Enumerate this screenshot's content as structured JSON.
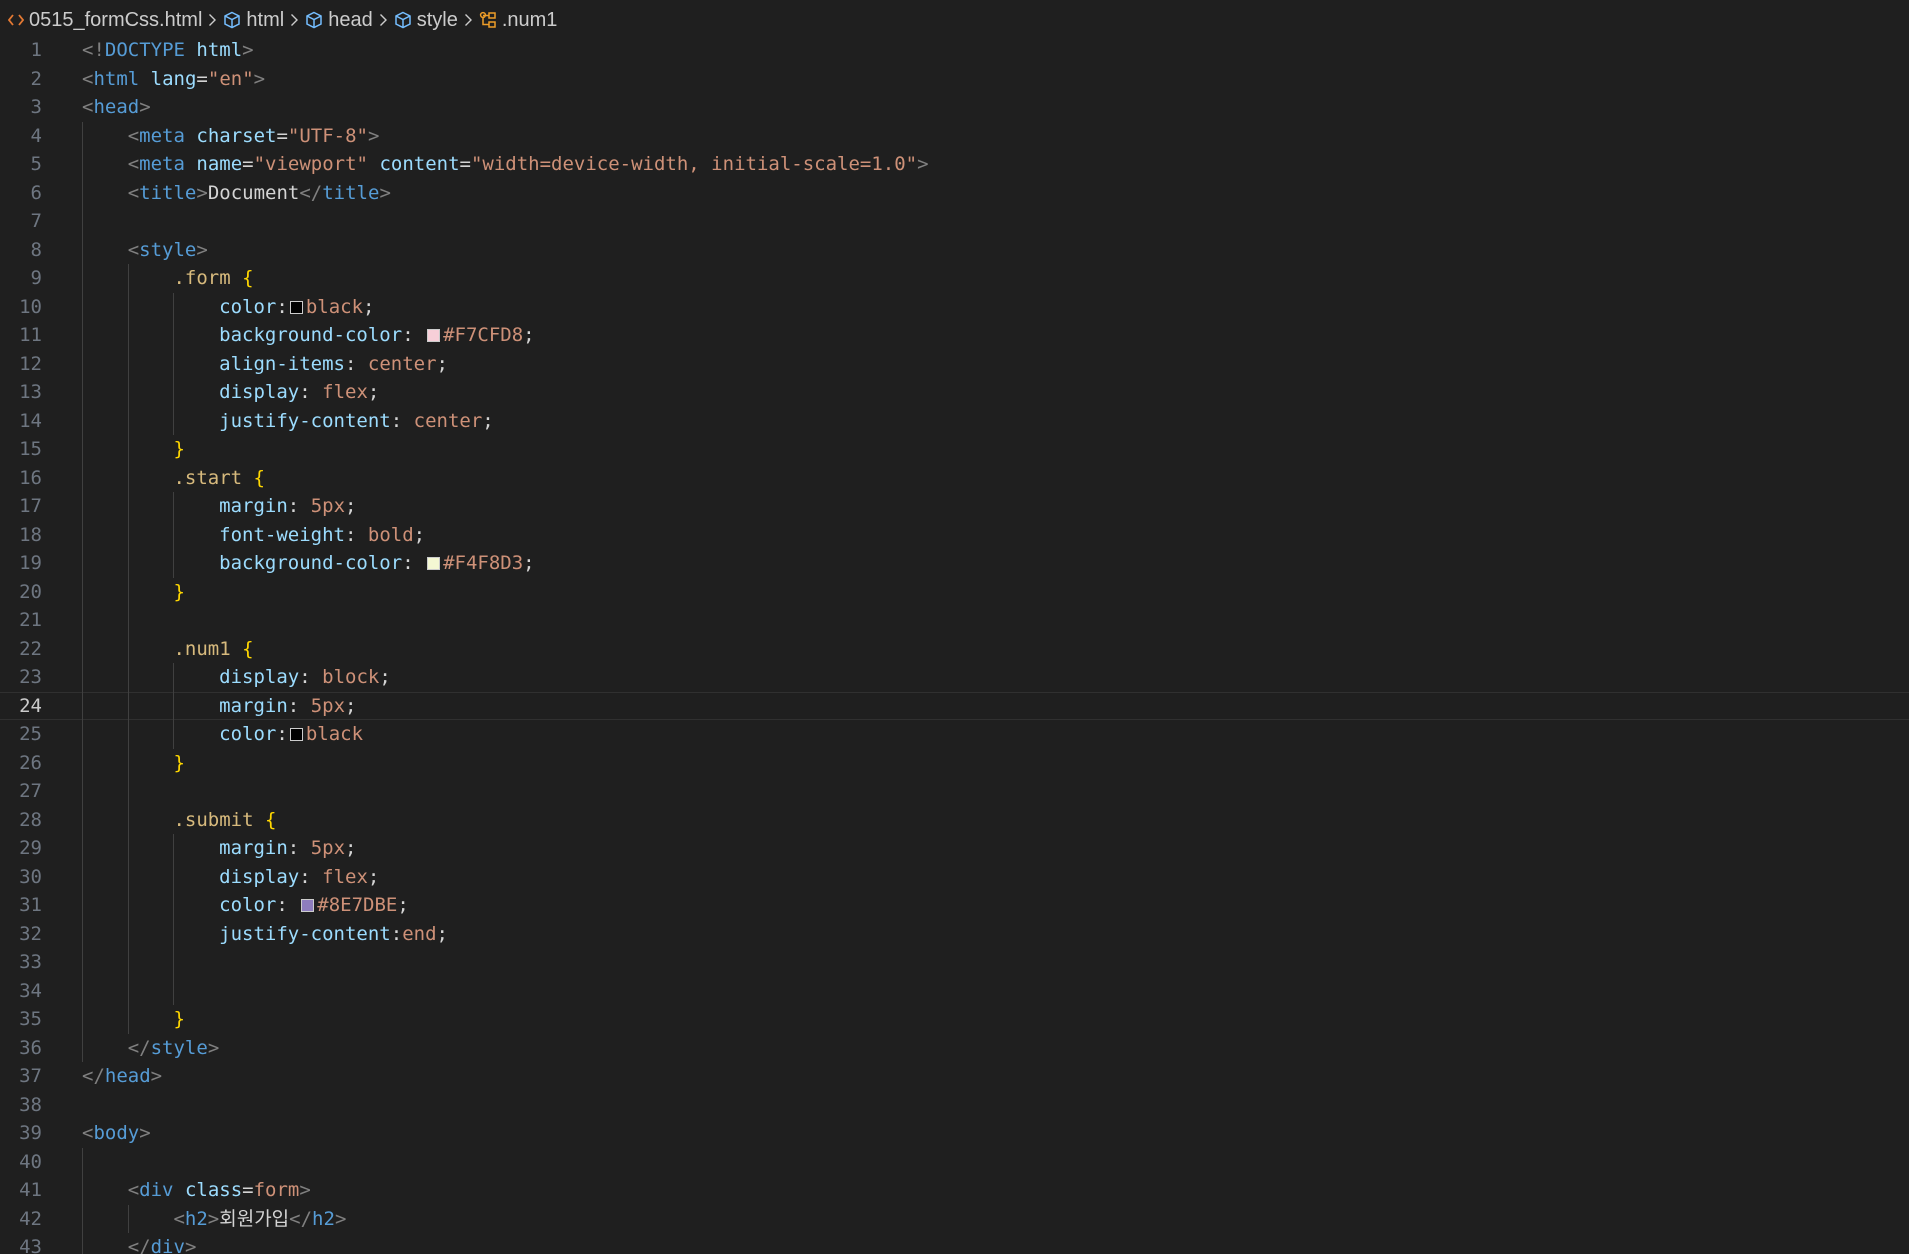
{
  "breadcrumb": {
    "items": [
      {
        "label": "0515_formCss.html",
        "icon": "html-file-icon"
      },
      {
        "label": "html",
        "icon": "element-cube-icon"
      },
      {
        "label": "head",
        "icon": "element-cube-icon"
      },
      {
        "label": "style",
        "icon": "element-cube-icon"
      },
      {
        "label": ".num1",
        "icon": "css-selector-icon"
      }
    ]
  },
  "editor": {
    "current_line": 24,
    "lines": [
      {
        "n": 1,
        "i": 0,
        "t": [
          [
            "t-punct",
            "<!"
          ],
          [
            "t-tag",
            "DOCTYPE "
          ],
          [
            "t-attr",
            "html"
          ],
          [
            "t-punct",
            ">"
          ]
        ]
      },
      {
        "n": 2,
        "i": 0,
        "t": [
          [
            "t-punct",
            "<"
          ],
          [
            "t-tag",
            "html "
          ],
          [
            "t-attr",
            "lang"
          ],
          [
            "t-plain",
            "="
          ],
          [
            "t-str",
            "\"en\""
          ],
          [
            "t-punct",
            ">"
          ]
        ]
      },
      {
        "n": 3,
        "i": 0,
        "t": [
          [
            "t-punct",
            "<"
          ],
          [
            "t-tag",
            "head"
          ],
          [
            "t-punct",
            ">"
          ]
        ]
      },
      {
        "n": 4,
        "i": 1,
        "t": [
          [
            "t-punct",
            "<"
          ],
          [
            "t-tag",
            "meta "
          ],
          [
            "t-attr",
            "charset"
          ],
          [
            "t-plain",
            "="
          ],
          [
            "t-str",
            "\"UTF-8\""
          ],
          [
            "t-punct",
            ">"
          ]
        ]
      },
      {
        "n": 5,
        "i": 1,
        "t": [
          [
            "t-punct",
            "<"
          ],
          [
            "t-tag",
            "meta "
          ],
          [
            "t-attr",
            "name"
          ],
          [
            "t-plain",
            "="
          ],
          [
            "t-str",
            "\"viewport\" "
          ],
          [
            "t-attr",
            "content"
          ],
          [
            "t-plain",
            "="
          ],
          [
            "t-str",
            "\"width=device-width, initial-scale=1.0\""
          ],
          [
            "t-punct",
            ">"
          ]
        ]
      },
      {
        "n": 6,
        "i": 1,
        "t": [
          [
            "t-punct",
            "<"
          ],
          [
            "t-tag",
            "title"
          ],
          [
            "t-punct",
            ">"
          ],
          [
            "t-text",
            "Document"
          ],
          [
            "t-punct",
            "</"
          ],
          [
            "t-tag",
            "title"
          ],
          [
            "t-punct",
            ">"
          ]
        ]
      },
      {
        "n": 7,
        "i": 1,
        "t": []
      },
      {
        "n": 8,
        "i": 1,
        "t": [
          [
            "t-punct",
            "<"
          ],
          [
            "t-tag",
            "style"
          ],
          [
            "t-punct",
            ">"
          ]
        ]
      },
      {
        "n": 9,
        "i": 2,
        "t": [
          [
            "t-sel",
            ".form "
          ],
          [
            "t-brace",
            "{"
          ]
        ]
      },
      {
        "n": 10,
        "i": 3,
        "t": [
          [
            "t-prop",
            "color"
          ],
          [
            "t-plain",
            ":"
          ],
          [
            "swatch",
            "#000000"
          ],
          [
            "t-val",
            "black"
          ],
          [
            "t-plain",
            ";"
          ]
        ]
      },
      {
        "n": 11,
        "i": 3,
        "t": [
          [
            "t-prop",
            "background-color"
          ],
          [
            "t-plain",
            ": "
          ],
          [
            "swatch",
            "#F7CFD8"
          ],
          [
            "t-val",
            "#F7CFD8"
          ],
          [
            "t-plain",
            ";"
          ]
        ]
      },
      {
        "n": 12,
        "i": 3,
        "t": [
          [
            "t-prop",
            "align-items"
          ],
          [
            "t-plain",
            ": "
          ],
          [
            "t-val",
            "center"
          ],
          [
            "t-plain",
            ";"
          ]
        ]
      },
      {
        "n": 13,
        "i": 3,
        "t": [
          [
            "t-prop",
            "display"
          ],
          [
            "t-plain",
            ": "
          ],
          [
            "t-val",
            "flex"
          ],
          [
            "t-plain",
            ";"
          ]
        ]
      },
      {
        "n": 14,
        "i": 3,
        "t": [
          [
            "t-prop",
            "justify-content"
          ],
          [
            "t-plain",
            ": "
          ],
          [
            "t-val",
            "center"
          ],
          [
            "t-plain",
            ";"
          ]
        ]
      },
      {
        "n": 15,
        "i": 2,
        "t": [
          [
            "t-brace",
            "}"
          ]
        ]
      },
      {
        "n": 16,
        "i": 2,
        "t": [
          [
            "t-sel",
            ".start "
          ],
          [
            "t-brace",
            "{"
          ]
        ]
      },
      {
        "n": 17,
        "i": 3,
        "t": [
          [
            "t-prop",
            "margin"
          ],
          [
            "t-plain",
            ": "
          ],
          [
            "t-val",
            "5px"
          ],
          [
            "t-plain",
            ";"
          ]
        ]
      },
      {
        "n": 18,
        "i": 3,
        "t": [
          [
            "t-prop",
            "font-weight"
          ],
          [
            "t-plain",
            ": "
          ],
          [
            "t-val",
            "bold"
          ],
          [
            "t-plain",
            ";"
          ]
        ]
      },
      {
        "n": 19,
        "i": 3,
        "t": [
          [
            "t-prop",
            "background-color"
          ],
          [
            "t-plain",
            ": "
          ],
          [
            "swatch",
            "#F4F8D3"
          ],
          [
            "t-val",
            "#F4F8D3"
          ],
          [
            "t-plain",
            ";"
          ]
        ]
      },
      {
        "n": 20,
        "i": 2,
        "t": [
          [
            "t-brace",
            "}"
          ]
        ]
      },
      {
        "n": 21,
        "i": 2,
        "t": []
      },
      {
        "n": 22,
        "i": 2,
        "t": [
          [
            "t-sel",
            ".num1 "
          ],
          [
            "t-brace",
            "{"
          ]
        ]
      },
      {
        "n": 23,
        "i": 3,
        "t": [
          [
            "t-prop",
            "display"
          ],
          [
            "t-plain",
            ": "
          ],
          [
            "t-val",
            "block"
          ],
          [
            "t-plain",
            ";"
          ]
        ]
      },
      {
        "n": 24,
        "i": 3,
        "t": [
          [
            "t-prop",
            "margin"
          ],
          [
            "t-plain",
            ": "
          ],
          [
            "t-val",
            "5px"
          ],
          [
            "t-plain",
            ";"
          ]
        ]
      },
      {
        "n": 25,
        "i": 3,
        "t": [
          [
            "t-prop",
            "color"
          ],
          [
            "t-plain",
            ":"
          ],
          [
            "swatch",
            "#000000"
          ],
          [
            "t-val",
            "black"
          ]
        ]
      },
      {
        "n": 26,
        "i": 2,
        "t": [
          [
            "t-brace",
            "}"
          ]
        ]
      },
      {
        "n": 27,
        "i": 2,
        "t": []
      },
      {
        "n": 28,
        "i": 2,
        "t": [
          [
            "t-sel",
            ".submit "
          ],
          [
            "t-brace",
            "{"
          ]
        ]
      },
      {
        "n": 29,
        "i": 3,
        "t": [
          [
            "t-prop",
            "margin"
          ],
          [
            "t-plain",
            ": "
          ],
          [
            "t-val",
            "5px"
          ],
          [
            "t-plain",
            ";"
          ]
        ]
      },
      {
        "n": 30,
        "i": 3,
        "t": [
          [
            "t-prop",
            "display"
          ],
          [
            "t-plain",
            ": "
          ],
          [
            "t-val",
            "flex"
          ],
          [
            "t-plain",
            ";"
          ]
        ]
      },
      {
        "n": 31,
        "i": 3,
        "t": [
          [
            "t-prop",
            "color"
          ],
          [
            "t-plain",
            ": "
          ],
          [
            "swatch",
            "#8E7DBE"
          ],
          [
            "t-val",
            "#8E7DBE"
          ],
          [
            "t-plain",
            ";"
          ]
        ]
      },
      {
        "n": 32,
        "i": 3,
        "t": [
          [
            "t-prop",
            "justify-content"
          ],
          [
            "t-plain",
            ":"
          ],
          [
            "t-val",
            "end"
          ],
          [
            "t-plain",
            ";"
          ]
        ]
      },
      {
        "n": 33,
        "i": 3,
        "t": []
      },
      {
        "n": 34,
        "i": 3,
        "t": []
      },
      {
        "n": 35,
        "i": 2,
        "t": [
          [
            "t-brace",
            "}"
          ]
        ]
      },
      {
        "n": 36,
        "i": 1,
        "t": [
          [
            "t-punct",
            "</"
          ],
          [
            "t-tag",
            "style"
          ],
          [
            "t-punct",
            ">"
          ]
        ]
      },
      {
        "n": 37,
        "i": 0,
        "t": [
          [
            "t-punct",
            "</"
          ],
          [
            "t-tag",
            "head"
          ],
          [
            "t-punct",
            ">"
          ]
        ]
      },
      {
        "n": 38,
        "i": 0,
        "t": []
      },
      {
        "n": 39,
        "i": 0,
        "t": [
          [
            "t-punct",
            "<"
          ],
          [
            "t-tag",
            "body"
          ],
          [
            "t-punct",
            ">"
          ]
        ]
      },
      {
        "n": 40,
        "i": 1,
        "t": []
      },
      {
        "n": 41,
        "i": 1,
        "t": [
          [
            "t-punct",
            "<"
          ],
          [
            "t-tag",
            "div "
          ],
          [
            "t-attr",
            "class"
          ],
          [
            "t-plain",
            "="
          ],
          [
            "t-str",
            "form"
          ],
          [
            "t-punct",
            ">"
          ]
        ]
      },
      {
        "n": 42,
        "i": 2,
        "t": [
          [
            "t-punct",
            "<"
          ],
          [
            "t-tag",
            "h2"
          ],
          [
            "t-punct",
            ">"
          ],
          [
            "t-text",
            "회원가입"
          ],
          [
            "t-punct",
            "</"
          ],
          [
            "t-tag",
            "h2"
          ],
          [
            "t-punct",
            ">"
          ]
        ]
      },
      {
        "n": 43,
        "i": 1,
        "t": [
          [
            "t-punct",
            "</"
          ],
          [
            "t-tag",
            "div"
          ],
          [
            "t-punct",
            ">"
          ]
        ]
      }
    ]
  }
}
